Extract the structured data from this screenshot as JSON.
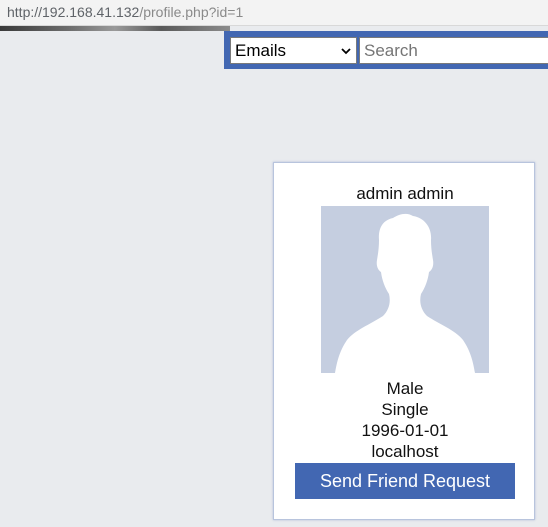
{
  "browser": {
    "url_host": "http://192.168.41.132",
    "url_path": "/profile.php?id=1"
  },
  "header": {
    "select_value": "Emails",
    "search_placeholder": "Search",
    "bar_color": "#4267b2"
  },
  "profile": {
    "name": "admin admin",
    "avatar_icon": "default-avatar-silhouette",
    "gender": "Male",
    "relationship": "Single",
    "birthday": "1996-01-01",
    "location": "localhost",
    "friend_button_label": "Send Friend Request"
  }
}
